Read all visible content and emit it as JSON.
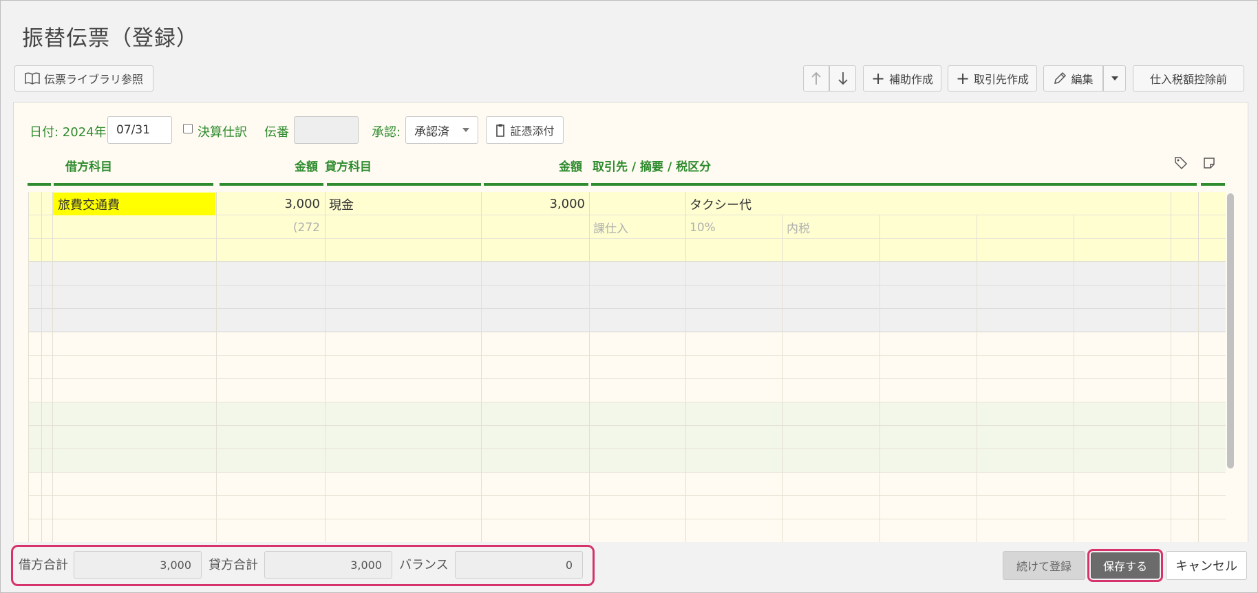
{
  "page": {
    "title": "振替伝票（登録）"
  },
  "toolbar": {
    "library_label": "伝票ライブラリ参照",
    "sub_create_label": "補助作成",
    "partner_create_label": "取引先作成",
    "edit_label": "編集",
    "tax_label": "仕入税額控除前"
  },
  "form": {
    "date_label": "日付: 2024年",
    "date_value": "07/31",
    "closing_label": "決算仕訳",
    "slip_no_label": "伝番",
    "slip_no_value": "",
    "approval_label": "承認:",
    "approval_value": "承認済",
    "attach_label": "証憑添付"
  },
  "table": {
    "headers": {
      "debit_account": "借方科目",
      "debit_amount": "金額",
      "credit_account": "貸方科目",
      "credit_amount": "金額",
      "partner_memo_tax": "取引先 / 摘要 / 税区分"
    },
    "entry": {
      "debit_account": "旅費交通費",
      "debit_amount": "3,000",
      "credit_account": "現金",
      "credit_amount": "3,000",
      "memo": "タクシー代",
      "sub_amount": "(272",
      "tax_category": "課仕入",
      "tax_rate": "10%",
      "tax_type": "内税"
    }
  },
  "totals": {
    "debit_label": "借方合計",
    "debit_value": "3,000",
    "credit_label": "貸方合計",
    "credit_value": "3,000",
    "balance_label": "バランス",
    "balance_value": "0"
  },
  "actions": {
    "continue_label": "続けて登録",
    "save_label": "保存する",
    "cancel_label": "キャンセル"
  },
  "colors": {
    "accent_green": "#2e8b2e",
    "highlight_yellow": "#ffff00",
    "annotation_pink": "#d6336c",
    "save_button": "#6b6b6b"
  }
}
